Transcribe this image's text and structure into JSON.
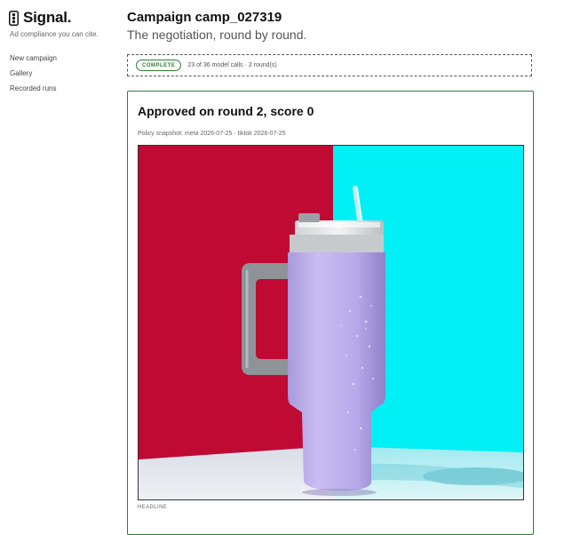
{
  "sidebar": {
    "brand": "Signal.",
    "tagline": "Ad compliance you can cite.",
    "nav": [
      {
        "label": "New campaign"
      },
      {
        "label": "Gallery"
      },
      {
        "label": "Recorded runs"
      }
    ]
  },
  "main": {
    "title": "Campaign camp_027319",
    "subtitle": "The negotiation, round by round.",
    "status": {
      "badge": "COMPLETE",
      "text": "23 of 36 model calls · 2 round(s)",
      "color": "#2e7d32"
    },
    "result": {
      "title": "Approved on round 2, score 0",
      "snapshot": "Policy snapshot: meta 2026-07-25 · tiktok 2026-07-25",
      "image_alt": "Lavender insulated tumbler with handle and straw on red and cyan backdrop",
      "field_label": "HEADLINE"
    }
  }
}
